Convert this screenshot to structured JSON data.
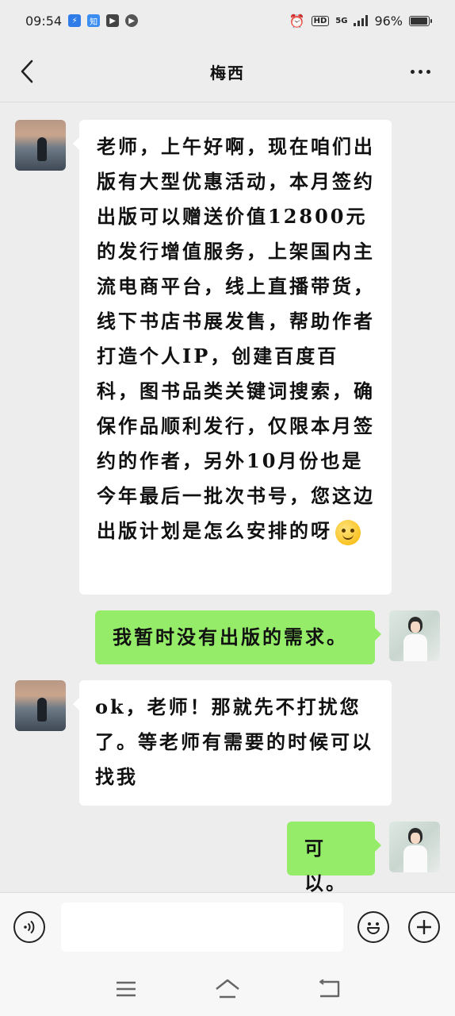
{
  "status_bar": {
    "time": "09:54",
    "battery": "96%",
    "network": "5G",
    "hd": "HD",
    "app_icons": [
      "lightning-app-icon",
      "zhihu-app-icon",
      "play-app-icon",
      "video-app-icon"
    ]
  },
  "header": {
    "title": "梅西",
    "back_icon": "chevron-left-icon",
    "more_icon": "more-dots-icon"
  },
  "messages": [
    {
      "sender": "other",
      "text": "老师，上午好啊，现在咱们出版有大型优惠活动，本月签约出版可以赠送价值12800元的发行增值服务，上架国内主流电商平台，线上直播带货，线下书店书展发售，帮助作者打造个人IP，创建百度百科，图书品类关键词搜索，确保作品顺利发行，仅限本月签约的作者，另外10月份也是今年最后一批次书号，您这边出版计划是怎么安排的呀",
      "emoji": "smiling-face-emoji"
    },
    {
      "sender": "me",
      "text": "我暂时没有出版的需求。"
    },
    {
      "sender": "other",
      "text": "ok，老师！那就先不打扰您了。等老师有需要的时候可以找我"
    },
    {
      "sender": "me",
      "text": "可以。"
    }
  ],
  "input_bar": {
    "voice_icon": "voice-icon",
    "emoji_icon": "emoji-icon",
    "plus_icon": "plus-icon",
    "input_value": ""
  },
  "system_nav": {
    "menu_icon": "menu-icon",
    "home_icon": "home-icon",
    "back_icon": "return-icon"
  },
  "colors": {
    "background": "#ededed",
    "my_bubble": "#95ec69",
    "other_bubble": "#ffffff"
  }
}
